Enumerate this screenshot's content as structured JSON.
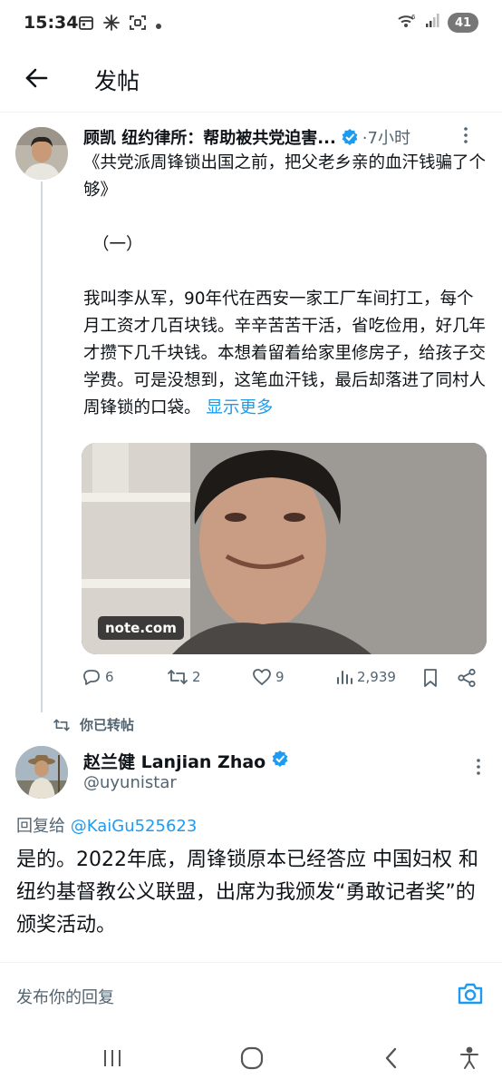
{
  "status_bar": {
    "time": "15:34",
    "battery": "41"
  },
  "header": {
    "title": "发帖"
  },
  "tweet1": {
    "author_name": "顾凯 纽约律所：帮助被共党迫害...",
    "time": "·7小时",
    "paragraphs": [
      "《共党派周锋锁出国之前，把父老乡亲的血汗钱骗了个够》",
      "（一）",
      "我叫李从军，90年代在西安一家工厂车间打工，每个月工资才几百块钱。辛辛苦苦干活，省吃俭用，好几年才攒下几千块钱。本想着留着给家里修房子，给孩子交学费。可是没想到，这笔血汗钱，最后却落进了同村人周锋锁的口袋。"
    ],
    "show_more": "显示更多",
    "media_badge": "note.com",
    "stats": {
      "replies": "6",
      "reposts": "2",
      "likes": "9",
      "views": "2,939"
    }
  },
  "repost_label": "你已转帖",
  "tweet2": {
    "author_name": "赵兰健 Lanjian Zhao",
    "handle": "@uyunistar",
    "reply_to_prefix": "回复给",
    "reply_to_handle": "@KaiGu525623",
    "text": "是的。2022年底，周锋锁原本已经答应 中国妇权 和 纽约基督教公义联盟，出席为我颁发“勇敢记者奖”的颁奖活动。"
  },
  "reply_bar": {
    "placeholder": "发布你的回复"
  },
  "colors": {
    "accent": "#1d9bf0",
    "muted": "#536471",
    "text": "#0f1419"
  }
}
